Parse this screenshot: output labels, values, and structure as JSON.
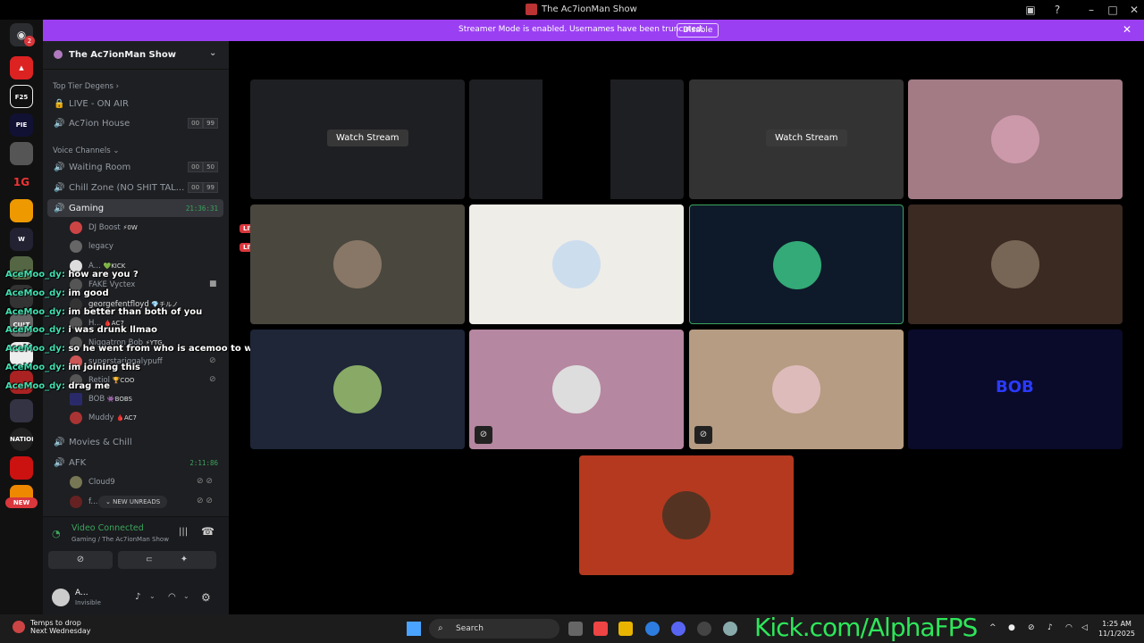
{
  "window": {
    "title": "The Ac7ionMan Show"
  },
  "banner": {
    "text": "Streamer Mode is enabled. Usernames have been truncated.",
    "disable_label": "Disable"
  },
  "rail": {
    "badge": "2",
    "new_label": "NEW",
    "servers": [
      "gamer-icon",
      "fps-icon",
      "pie-icon",
      "avatar-icon",
      "1g-icon",
      "burger-icon",
      "worlds-icon",
      "soldier-icon",
      "skull-icon",
      "cult-icon",
      "nation-icon",
      "bulls-icon",
      "batman-icon",
      "loot-icon"
    ]
  },
  "server": {
    "name": "The Ac7ionMan Show"
  },
  "categories": {
    "top": "Top Tier Degens",
    "voice": "Voice Channels"
  },
  "channels": {
    "live_on_air": "LIVE - ON AIR",
    "ac7ion_house": {
      "name": "Ac7ion House",
      "count_a": "00",
      "count_b": "99"
    },
    "waiting_room": {
      "name": "Waiting Room",
      "count_a": "00",
      "count_b": "50"
    },
    "chill_zone": {
      "name": "Chill Zone (NO SHIT TAL...",
      "count_a": "00",
      "count_b": "99"
    },
    "gaming": {
      "name": "Gaming",
      "timer": "21:36:31"
    },
    "movies": {
      "name": "Movies & Chill"
    },
    "afk": {
      "name": "AFK",
      "timer": "2:11:86"
    }
  },
  "gaming_users": [
    {
      "name": "DJ Boost",
      "tag": "⚡0W",
      "live": "LIVE"
    },
    {
      "name": "legacy",
      "tag": "",
      "live": "LIVE"
    },
    {
      "name": "A...",
      "tag": "💚KICK",
      "live": ""
    },
    {
      "name": "FAKE Vyctex",
      "tag": "",
      "live": ""
    },
    {
      "name": "georgefentfloyd",
      "tag": "💎チルノ",
      "live": ""
    },
    {
      "name": "H...",
      "tag": "🩸AC7",
      "live": ""
    },
    {
      "name": "Niggatron Bob",
      "tag": "⚡YTG",
      "live": ""
    },
    {
      "name": "superstariggalypuff",
      "tag": "",
      "live": ""
    },
    {
      "name": "Retiol",
      "tag": "🏆COO",
      "live": ""
    },
    {
      "name": "BOB",
      "tag": "👾BOBS",
      "live": ""
    },
    {
      "name": "Muddy",
      "tag": "🩸AC7",
      "live": ""
    }
  ],
  "afk_users": [
    {
      "name": "Cloud9"
    },
    {
      "name": "f..."
    }
  ],
  "new_unreads": "NEW UNREADS",
  "chat": [
    {
      "name": "AceMoo_dy:",
      "msg": "how are you ?"
    },
    {
      "name": "AceMoo_dy:",
      "msg": "im good"
    },
    {
      "name": "AceMoo_dy:",
      "msg": "im better than both of you"
    },
    {
      "name": "AceMoo_dy:",
      "msg": "i was drunk llmao"
    },
    {
      "name": "AceMoo_dy:",
      "msg": "so he went from who is acemoo to when we played with acemoo"
    },
    {
      "name": "AceMoo_dy:",
      "msg": "im joining this"
    },
    {
      "name": "AceMoo_dy:",
      "msg": "drag me"
    }
  ],
  "voice": {
    "status": "Video Connected",
    "location": "Gaming / The Ac7ionMan Show"
  },
  "account": {
    "name": "A...",
    "status": "Invisible"
  },
  "tiles": {
    "watch_stream": "Watch Stream"
  },
  "colors": {
    "accent": "#9b3ff3",
    "speaking": "#3ba55d",
    "live": "#da373c"
  },
  "taskbar": {
    "weather_title": "Temps to drop",
    "weather_sub": "Next Wednesday",
    "search": "Search",
    "time": "1:25 AM",
    "date": "11/1/2025"
  },
  "overlay": {
    "kick": "Kick.com/AlphaFPS"
  }
}
